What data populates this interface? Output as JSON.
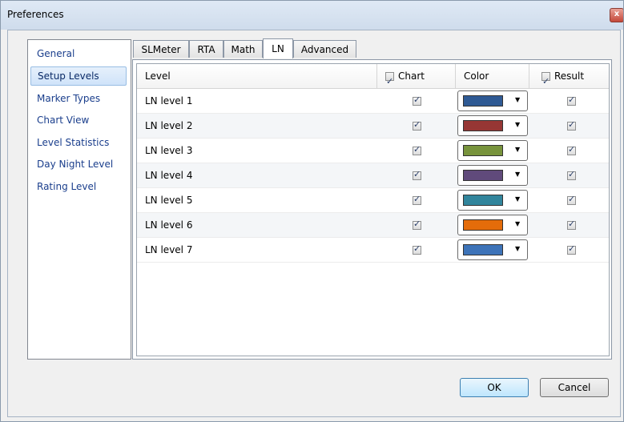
{
  "window": {
    "title": "Preferences",
    "close_symbol": "x"
  },
  "nav": {
    "items": [
      {
        "label": "General"
      },
      {
        "label": "Setup Levels"
      },
      {
        "label": "Marker Types"
      },
      {
        "label": "Chart View"
      },
      {
        "label": "Level Statistics"
      },
      {
        "label": "Day Night Level"
      },
      {
        "label": "Rating Level"
      }
    ],
    "selected": "Setup Levels"
  },
  "tabs": [
    {
      "label": "SLMeter"
    },
    {
      "label": "RTA"
    },
    {
      "label": "Math"
    },
    {
      "label": "LN"
    },
    {
      "label": "Advanced"
    }
  ],
  "active_tab": "LN",
  "grid": {
    "headers": {
      "level": "Level",
      "chart": "Chart",
      "color": "Color",
      "result": "Result"
    },
    "header_chart_checked": true,
    "header_result_checked": true,
    "rows": [
      {
        "label": "LN level 1",
        "chart": true,
        "color": "#2f5a94",
        "result": true
      },
      {
        "label": "LN level 2",
        "chart": true,
        "color": "#963634",
        "result": true
      },
      {
        "label": "LN level 3",
        "chart": true,
        "color": "#77933c",
        "result": true
      },
      {
        "label": "LN level 4",
        "chart": true,
        "color": "#604a7b",
        "result": true
      },
      {
        "label": "LN level 5",
        "chart": true,
        "color": "#31859c",
        "result": true
      },
      {
        "label": "LN level 6",
        "chart": true,
        "color": "#e46c0a",
        "result": true
      },
      {
        "label": "LN level 7",
        "chart": true,
        "color": "#3d73b8",
        "result": true
      }
    ]
  },
  "buttons": {
    "ok": "OK",
    "cancel": "Cancel"
  }
}
